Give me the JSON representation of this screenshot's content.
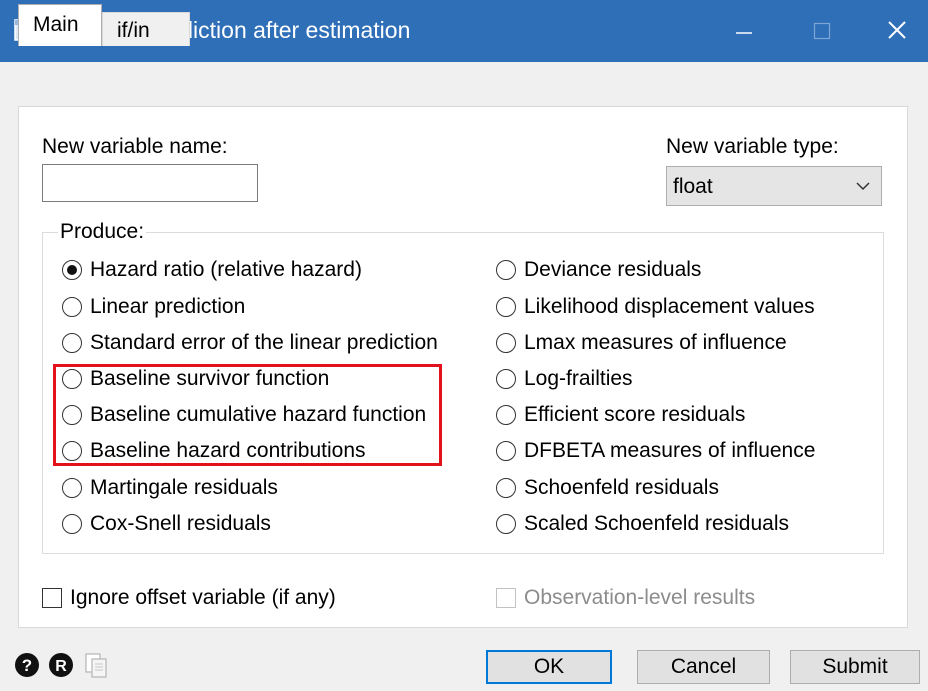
{
  "window": {
    "title": "predict - Prediction after estimation",
    "title_bar_color": "#2f6fb8"
  },
  "tabs": [
    {
      "label": "Main",
      "active": true
    },
    {
      "label": "if/in",
      "active": false
    }
  ],
  "main": {
    "new_var_name_label": "New variable name:",
    "new_var_name_value": "",
    "new_var_type_label": "New variable type:",
    "new_var_type_value": "float",
    "produce_label": "Produce:",
    "options_left": [
      {
        "label": "Hazard ratio (relative hazard)",
        "selected": true
      },
      {
        "label": "Linear prediction",
        "selected": false
      },
      {
        "label": "Standard error of the linear prediction",
        "selected": false
      },
      {
        "label": "Baseline survivor function",
        "selected": false
      },
      {
        "label": "Baseline cumulative hazard function",
        "selected": false
      },
      {
        "label": "Baseline hazard contributions",
        "selected": false
      },
      {
        "label": "Martingale residuals",
        "selected": false
      },
      {
        "label": "Cox-Snell residuals",
        "selected": false
      }
    ],
    "options_right": [
      {
        "label": "Deviance residuals",
        "selected": false
      },
      {
        "label": "Likelihood displacement values",
        "selected": false
      },
      {
        "label": "Lmax measures of influence",
        "selected": false
      },
      {
        "label": "Log-frailties",
        "selected": false
      },
      {
        "label": "Efficient score residuals",
        "selected": false
      },
      {
        "label": "DFBETA measures of influence",
        "selected": false
      },
      {
        "label": "Schoenfeld residuals",
        "selected": false
      },
      {
        "label": "Scaled Schoenfeld residuals",
        "selected": false
      }
    ],
    "ignore_offset_label": "Ignore offset variable (if any)",
    "ignore_offset_checked": false,
    "observation_level_label": "Observation-level results",
    "observation_level_enabled": false,
    "highlight_color": "#e3111b"
  },
  "footer": {
    "icons": [
      "help-icon",
      "reset-icon",
      "copy-icon"
    ],
    "ok_label": "OK",
    "cancel_label": "Cancel",
    "submit_label": "Submit"
  }
}
